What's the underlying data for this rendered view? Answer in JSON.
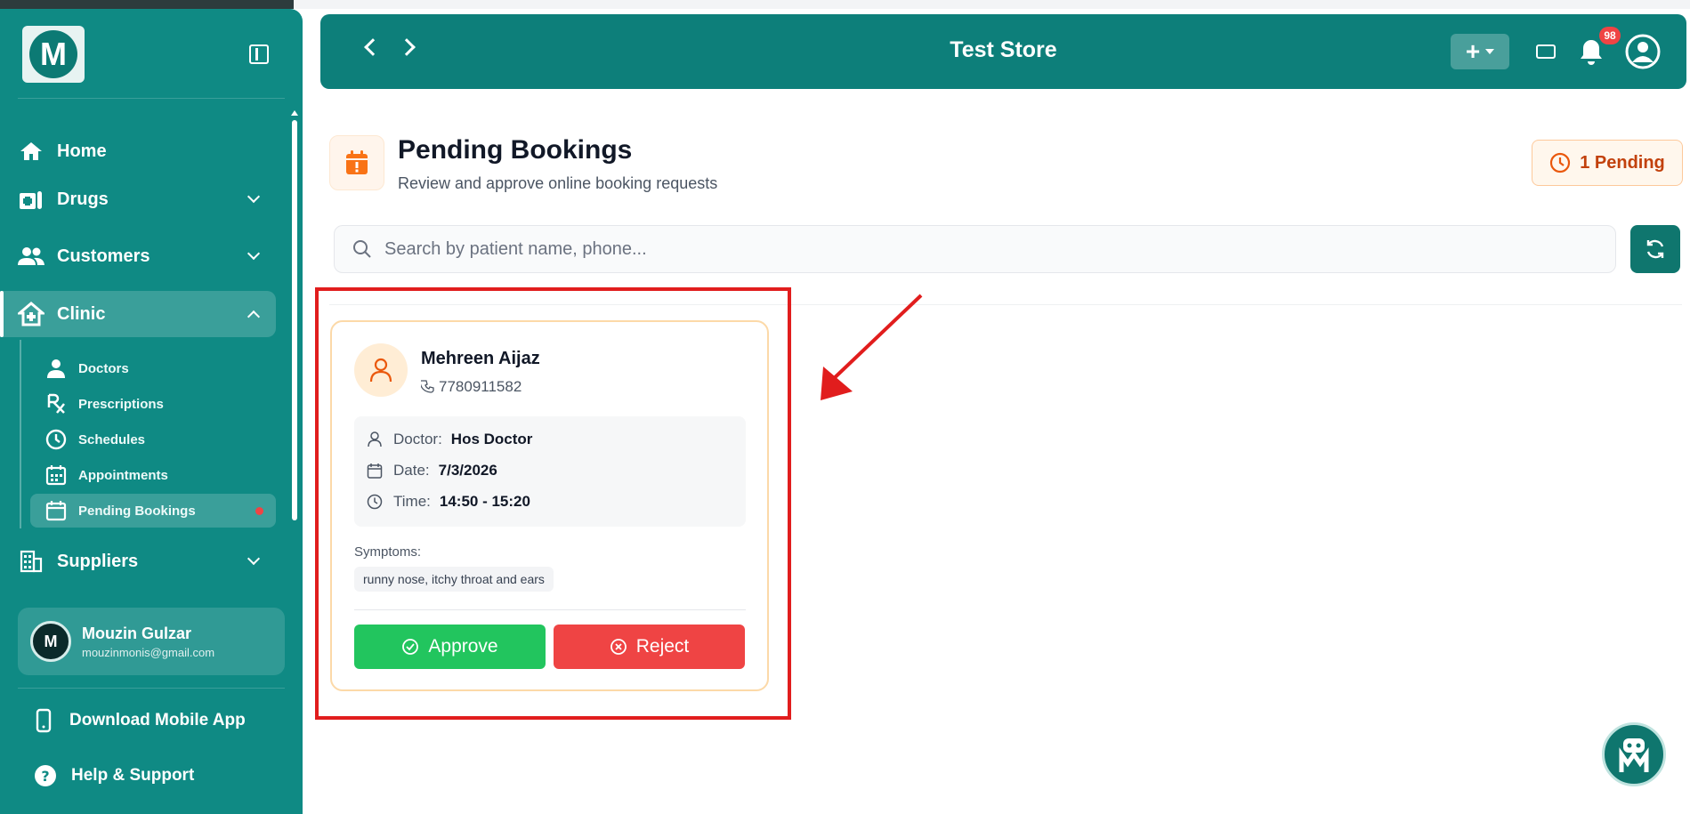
{
  "sidebar": {
    "logo": "M",
    "nav": {
      "home": "Home",
      "drugs": "Drugs",
      "customers": "Customers",
      "clinic": "Clinic",
      "suppliers": "Suppliers"
    },
    "clinic_sub": {
      "doctors": "Doctors",
      "prescriptions": "Prescriptions",
      "schedules": "Schedules",
      "appointments": "Appointments",
      "pending_bookings": "Pending Bookings"
    },
    "user": {
      "initial": "M",
      "name": "Mouzin Gulzar",
      "email": "mouzinmonis@gmail.com"
    },
    "download_app": "Download Mobile App",
    "help": "Help & Support"
  },
  "header": {
    "title": "Test Store",
    "plus": "+",
    "notification_count": "98"
  },
  "page": {
    "title": "Pending Bookings",
    "subtitle": "Review and approve online booking requests",
    "pending_badge": "1 Pending",
    "search_placeholder": "Search by patient name, phone..."
  },
  "booking": {
    "patient_name": "Mehreen Aijaz",
    "phone": "7780911582",
    "doctor_label": "Doctor:",
    "doctor": "Hos Doctor",
    "date_label": "Date:",
    "date": "7/3/2026",
    "time_label": "Time:",
    "time": "14:50 - 15:20",
    "symptoms_label": "Symptoms:",
    "symptoms": "runny nose, itchy throat and ears",
    "approve_label": "Approve",
    "reject_label": "Reject"
  },
  "colors": {
    "primary": "#0f8a84",
    "approve": "#22c55e",
    "reject": "#ef4444",
    "pending": "#c2410c",
    "annotation": "#e11d1d"
  }
}
